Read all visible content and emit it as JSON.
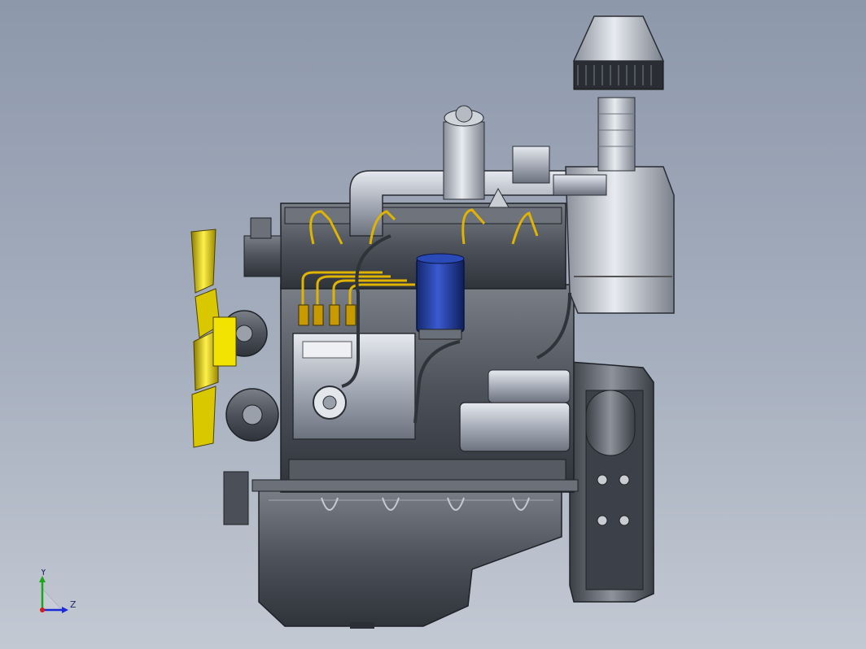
{
  "viewport": {
    "model": "diesel-engine-assembly",
    "background_top": "#8d98ab",
    "background_bottom": "#c3c9d3"
  },
  "colors": {
    "metal_light": "#d9dde6",
    "metal_mid": "#9aa1ad",
    "metal_dark": "#4a4f58",
    "fuel_lines": "#e0b400",
    "filter_blue": "#1f3a9c",
    "fan_yellow": "#e6d000"
  },
  "triad": {
    "y_label": "Y",
    "z_label": "Z",
    "y_color": "#1aa81a",
    "z_color": "#1a2ad6",
    "x_color": "#d61a1a"
  }
}
